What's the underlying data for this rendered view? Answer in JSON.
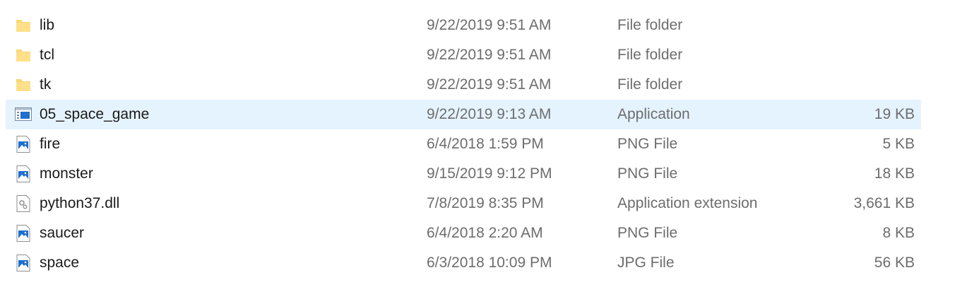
{
  "files": [
    {
      "name": "lib",
      "date": "9/22/2019 9:51 AM",
      "type": "File folder",
      "size": "",
      "icon": "folder-icon"
    },
    {
      "name": "tcl",
      "date": "9/22/2019 9:51 AM",
      "type": "File folder",
      "size": "",
      "icon": "folder-icon"
    },
    {
      "name": "tk",
      "date": "9/22/2019 9:51 AM",
      "type": "File folder",
      "size": "",
      "icon": "folder-icon"
    },
    {
      "name": "05_space_game",
      "date": "9/22/2019 9:13 AM",
      "type": "Application",
      "size": "19 KB",
      "icon": "application-icon",
      "selected": true
    },
    {
      "name": "fire",
      "date": "6/4/2018 1:59 PM",
      "type": "PNG File",
      "size": "5 KB",
      "icon": "image-file-icon"
    },
    {
      "name": "monster",
      "date": "9/15/2019 9:12 PM",
      "type": "PNG File",
      "size": "18 KB",
      "icon": "image-file-icon"
    },
    {
      "name": "python37.dll",
      "date": "7/8/2019 8:35 PM",
      "type": "Application extension",
      "size": "3,661 KB",
      "icon": "dll-file-icon"
    },
    {
      "name": "saucer",
      "date": "6/4/2018 2:20 AM",
      "type": "PNG File",
      "size": "8 KB",
      "icon": "image-file-icon"
    },
    {
      "name": "space",
      "date": "6/3/2018 10:09 PM",
      "type": "JPG File",
      "size": "56 KB",
      "icon": "image-file-icon"
    }
  ],
  "colors": {
    "selected_row": "#e5f3ff",
    "name_text": "#1a1a1a",
    "detail_text": "#6d6d6d",
    "folder": "#f8d775",
    "image_accent": "#1e6fd0"
  }
}
